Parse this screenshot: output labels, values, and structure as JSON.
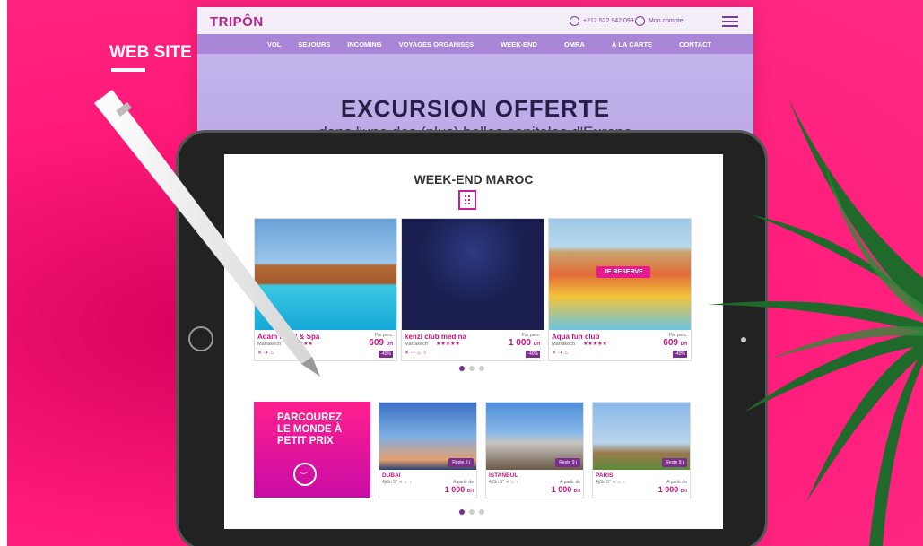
{
  "label": {
    "web_site": "WEB SITE"
  },
  "site": {
    "logo": "TRIPÔN",
    "phone": "+212 522 942 099",
    "account": "Mon compte",
    "nav": [
      "VOL",
      "SEJOURS",
      "INCOMING",
      "VOYAGES ORGANISES",
      "WEEK-END",
      "OMRA",
      "À LA CARTE",
      "CONTACT"
    ],
    "headline": "EXCURSION OFFERTE",
    "subline": "dans l'une des (plus) belles capitales d'Europe"
  },
  "tablet": {
    "section_title": "WEEK-END MAROC",
    "cards": [
      {
        "name": "Adam      Hotel & Spa",
        "location": "Marrakech",
        "stars": "★★★★★",
        "per_pers": "Par pers.",
        "price": "609",
        "unit": "DH",
        "discount": "-40%",
        "icons": "✕ ⇢ ♨"
      },
      {
        "name": "kenzi club medina",
        "location": "Marrakech",
        "stars": "★★★★★",
        "per_pers": "Par pers.",
        "price": "1 000",
        "unit": "DH",
        "discount": "-40%",
        "icons": "✕ ⇢ ♨ ♀"
      },
      {
        "name": "Aqua fun club",
        "location": "Marrakech",
        "stars": "★★★★★",
        "per_pers": "Par pers.",
        "price": "609",
        "unit": "DH",
        "discount": "-40%",
        "icons": "✕ ⇢ ♨",
        "cta": "JE RESERVE"
      }
    ],
    "promo": "PARCOUREZ LE MONDE À PETIT PRIX",
    "destinations": [
      {
        "name": "DUBAI",
        "details": "4j/3n 5* ✕ ♨ ♀",
        "badge": "Reste 9 j",
        "from": "A partir de",
        "price": "1 000",
        "unit": "DH"
      },
      {
        "name": "ISTANBUL",
        "details": "4j/3n 5* ✕ ♨ ♀",
        "badge": "Reste 9 j",
        "from": "A partir de",
        "price": "1 000",
        "unit": "DH"
      },
      {
        "name": "PARIS",
        "details": "4j/3n 5* ✕ ♨ ♀",
        "badge": "Reste 9 j",
        "from": "A partir de",
        "price": "1 000",
        "unit": "DH"
      }
    ]
  },
  "colors": {
    "background": "#ff1a78",
    "accent": "#c0187c",
    "purple": "#7a2f8d"
  }
}
